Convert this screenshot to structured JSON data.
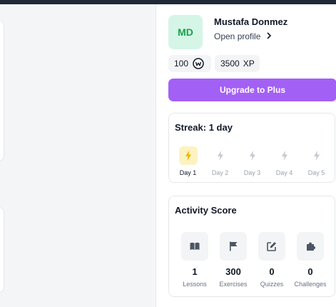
{
  "profile": {
    "initials": "MD",
    "name": "Mustafa Donmez",
    "open_profile_label": "Open profile"
  },
  "stats": {
    "coins": "100",
    "xp_value": "3500",
    "xp_unit": "XP"
  },
  "upgrade_label": "Upgrade to Plus",
  "streak": {
    "title": "Streak: 1 day",
    "days": [
      {
        "label": "Day 1",
        "active": true
      },
      {
        "label": "Day 2",
        "active": false
      },
      {
        "label": "Day 3",
        "active": false
      },
      {
        "label": "Day 4",
        "active": false
      },
      {
        "label": "Day 5",
        "active": false
      }
    ]
  },
  "activity": {
    "title": "Activity Score",
    "metrics": [
      {
        "value": "1",
        "label": "Lessons",
        "icon": "book-icon"
      },
      {
        "value": "300",
        "label": "Exercises",
        "icon": "flag-icon"
      },
      {
        "value": "0",
        "label": "Quizzes",
        "icon": "edit-icon"
      },
      {
        "value": "0",
        "label": "Challenges",
        "icon": "puzzle-icon"
      }
    ]
  },
  "colors": {
    "accent": "#a360f5",
    "avatar_bg": "#d5f5e6",
    "avatar_text": "#16a34a",
    "streak_active": "#f5b400",
    "streak_inactive": "#c7cbd1"
  }
}
